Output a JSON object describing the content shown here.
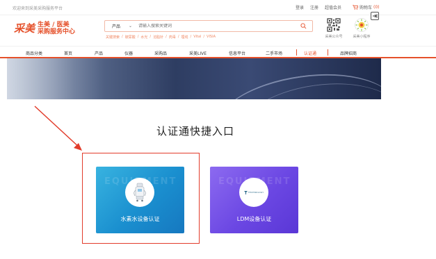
{
  "topbar": {
    "welcome": "欢迎来到采美采购服务平台",
    "login": "登录",
    "register": "注册",
    "vip": "超值会员",
    "cart_label": "购物车",
    "cart_count": "(0)"
  },
  "logo": {
    "mark": "采美",
    "line1": "生美 / 医美",
    "line2": "采购服务中心"
  },
  "search": {
    "category": "产品",
    "placeholder": "请输入搜索关键词",
    "hot_keywords": [
      "关键搜索",
      "玻尿酸",
      "水光",
      "溶脂针",
      "肉毒",
      "埋线",
      "Vital",
      "VISIA"
    ]
  },
  "qr_codes": [
    {
      "label": "采美公众号"
    },
    {
      "label": "采美小程序"
    }
  ],
  "nav": {
    "items": [
      "商品分类",
      "首页",
      "产品",
      "仪器",
      "采购品",
      "采美LIVE",
      "信息平台",
      "二手市场",
      "认证通",
      "品牌招商"
    ],
    "active_index": 8
  },
  "main": {
    "title": "认证通快捷入口",
    "cards": [
      {
        "label": "水素水设备认证",
        "watermark": "EQUIPMENT"
      },
      {
        "label": "LDM设备认证",
        "watermark": "EQUIPMENT",
        "logo_text": "TECHNOLOGY"
      }
    ]
  },
  "colors": {
    "brand": "#e5502a",
    "card_blue": "#1a8fcf",
    "card_purple": "#6b47e3",
    "highlight": "#e23b2a"
  }
}
